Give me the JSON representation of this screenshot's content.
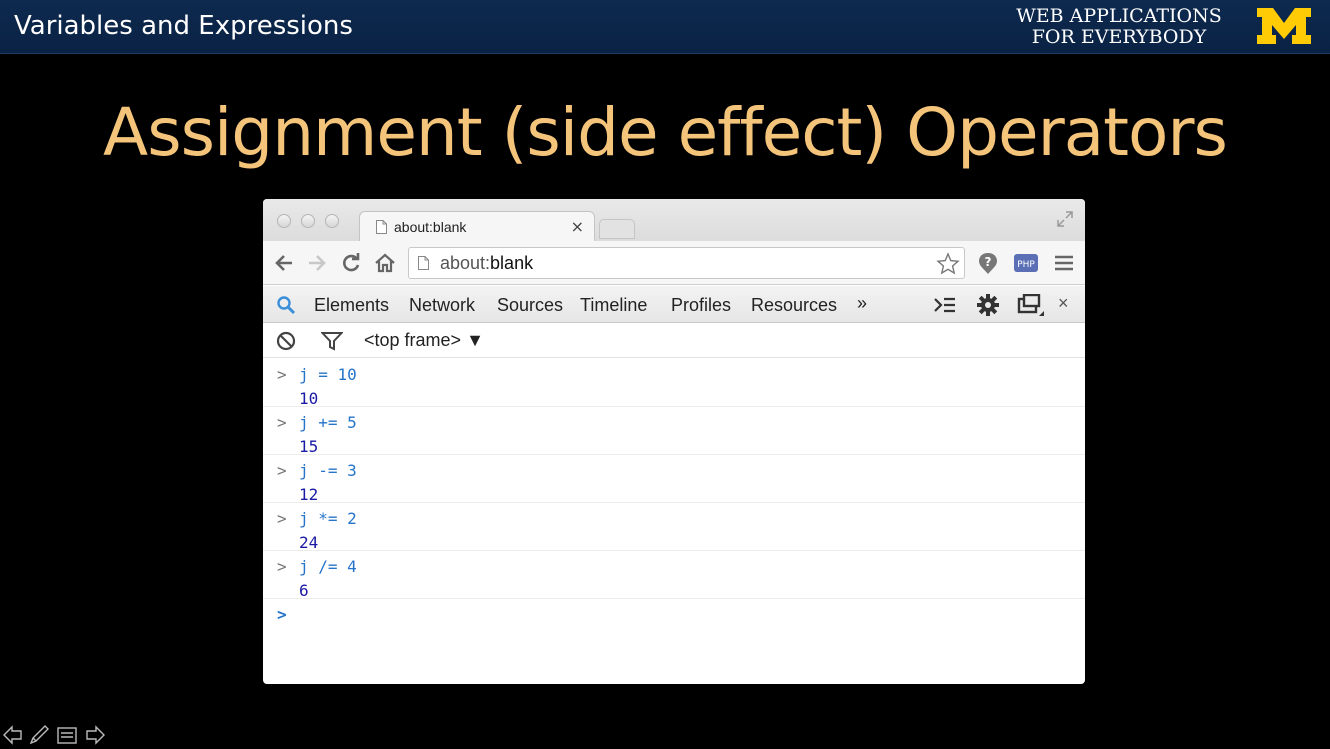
{
  "header": {
    "title": "Variables and Expressions",
    "brand_line1": "WEB APPLICATIONS",
    "brand_line2": "FOR EVERYBODY",
    "logo_letter": "M",
    "logo_color": "#FFCB05"
  },
  "slide": {
    "title": "Assignment (side effect) Operators",
    "title_color": "#F4C47A"
  },
  "browser": {
    "tab_label": "about:blank",
    "tab_close": "×",
    "url_prefix": "about:",
    "url_host": "blank",
    "toolbar_icons": [
      "back-arrow-icon",
      "forward-arrow-icon",
      "reload-icon",
      "home-icon",
      "star-icon",
      "help-icon",
      "php-extension-icon",
      "menu-icon"
    ],
    "php_badge": "PHP"
  },
  "devtools": {
    "tabs": [
      "Elements",
      "Network",
      "Sources",
      "Timeline",
      "Profiles",
      "Resources"
    ],
    "more": "»",
    "frame_selector": "<top frame>",
    "frame_arrow": "▼",
    "close": "×"
  },
  "console": {
    "prompt_symbol": ">",
    "entries": [
      {
        "command": "j = 10",
        "result": "10"
      },
      {
        "command": "j += 5",
        "result": "15"
      },
      {
        "command": "j -= 3",
        "result": "12"
      },
      {
        "command": "j *= 2",
        "result": "24"
      },
      {
        "command": "j /= 4",
        "result": "6"
      }
    ]
  }
}
